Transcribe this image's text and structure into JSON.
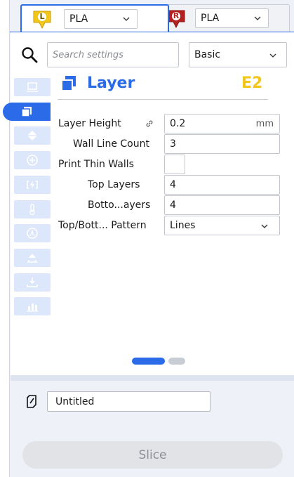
{
  "extruders": [
    {
      "badge": "L",
      "material": "PLA",
      "badge_color": "#f3c71a",
      "active": true
    },
    {
      "badge": "R",
      "material": "PLA",
      "badge_color": "#b3201e",
      "active": false
    }
  ],
  "search": {
    "placeholder": "Search settings"
  },
  "mode": {
    "selected": "Basic"
  },
  "categories": [
    {
      "icon": "printer-icon",
      "active": false
    },
    {
      "icon": "layer-icon",
      "active": true
    },
    {
      "icon": "shell-icon",
      "active": false
    },
    {
      "icon": "infill-icon",
      "active": false
    },
    {
      "icon": "material-icon",
      "active": false
    },
    {
      "icon": "temperature-icon",
      "active": false
    },
    {
      "icon": "cooling-icon",
      "active": false
    },
    {
      "icon": "support-icon",
      "active": false
    },
    {
      "icon": "adhesion-icon",
      "active": false
    },
    {
      "icon": "experimental-icon",
      "active": false
    }
  ],
  "section": {
    "title": "Layer",
    "extruder_label": "E2"
  },
  "settings": {
    "layer_height": {
      "label": "Layer Height",
      "value": "0.2",
      "unit": "mm"
    },
    "wall_line_count": {
      "label": "Wall Line Count",
      "value": "3"
    },
    "print_thin_walls": {
      "label": "Print Thin Walls",
      "checked": false
    },
    "top_layers": {
      "label": "Top Layers",
      "value": "4"
    },
    "bottom_layers": {
      "label": "Botto...ayers",
      "value": "4"
    },
    "top_bottom_pattern": {
      "label": "Top/Bott... Pattern",
      "value": "Lines"
    }
  },
  "pager": {
    "pages": 2,
    "current": 1
  },
  "job": {
    "name": "Untitled"
  },
  "slice": {
    "label": "Slice"
  },
  "colors": {
    "accent": "#2b6be8",
    "badge_yellow": "#f3c71a",
    "badge_red": "#b3201e"
  }
}
